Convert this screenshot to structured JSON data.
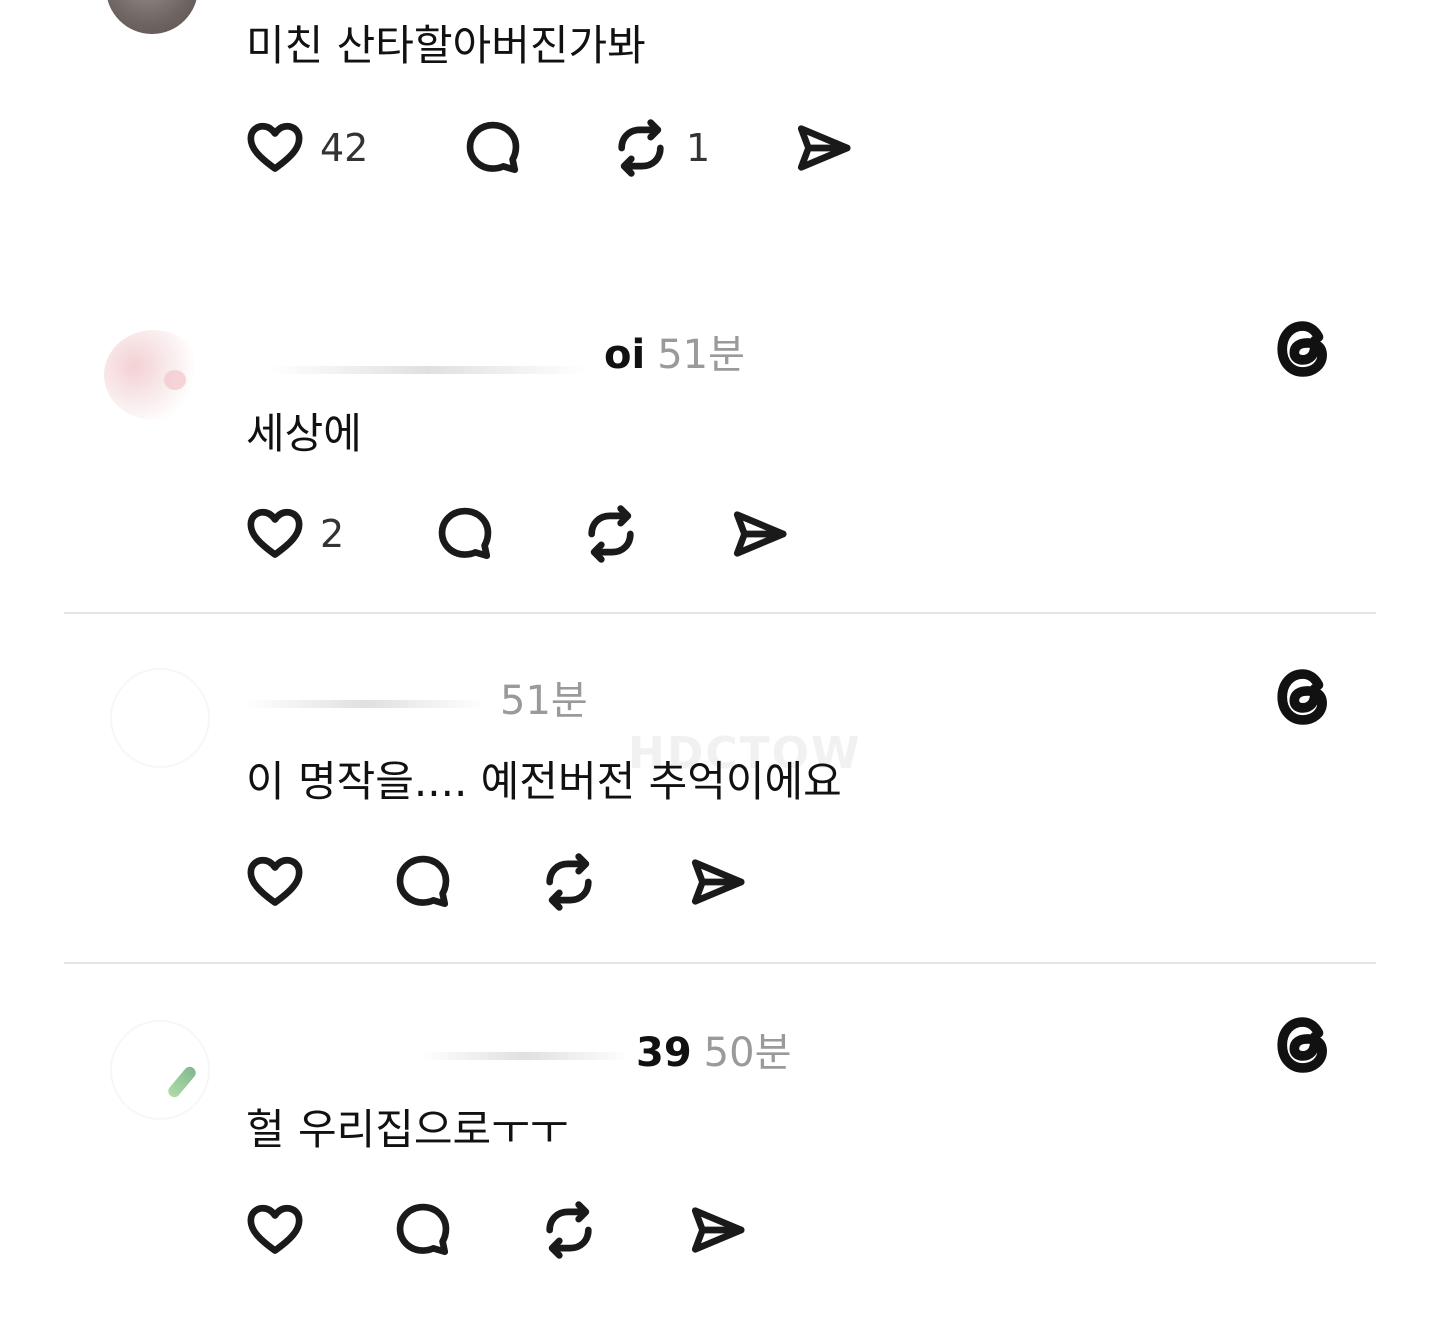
{
  "comments": [
    {
      "text": "미친 산타할아버진가봐",
      "likes": "42",
      "reposts": "1"
    },
    {
      "username": "oi",
      "time": "51분",
      "text": "세상에",
      "likes": "2"
    },
    {
      "time": "51분",
      "text": "이 명작을.... 예전버전 추억이에요"
    },
    {
      "username": "39",
      "time": "50분",
      "text": "헐 우리집으로ㅜㅜ"
    }
  ],
  "watermark": "HDCTOW",
  "icons": {
    "like": "heart-icon",
    "reply": "comment-bubble-icon",
    "repost": "repost-icon",
    "share": "send-icon",
    "app": "threads-logo-icon"
  },
  "colors": {
    "text": "#111111",
    "muted": "#9a9a9a",
    "divider": "#e4e4e4",
    "background": "#ffffff"
  }
}
